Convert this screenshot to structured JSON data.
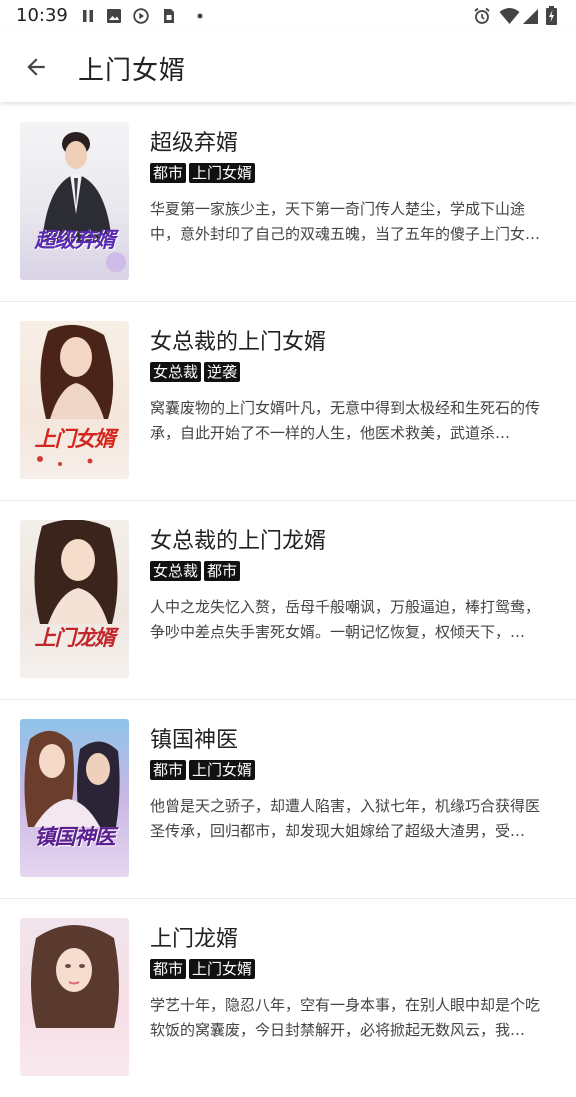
{
  "status_bar": {
    "time": "10:39",
    "icons_left": [
      "pause-icon",
      "image-icon",
      "play-circle-icon",
      "sim-card-icon",
      "dot-icon"
    ],
    "icons_right": [
      "alarm-icon",
      "wifi-icon",
      "cellular-signal-icon",
      "battery-charging-icon"
    ]
  },
  "app_bar": {
    "back_icon": "arrow-left-icon",
    "title": "上门女婿"
  },
  "colors": {
    "tag_background": "#111111",
    "tag_text": "#ffffff",
    "divider": "#ececec"
  },
  "books": [
    {
      "title": "超级弃婿",
      "tags": [
        "都市",
        "上门女婿"
      ],
      "description": "华夏第一家族少主，天下第一奇门传人楚尘，学成下山途中，意外封印了自己的双魂五魄，当了五年的傻子上门女婿……",
      "cover_text": "超级弃婿"
    },
    {
      "title": "女总裁的上门女婿",
      "tags": [
        "女总裁",
        "逆袭"
      ],
      "description": "窝囊废物的上门女婿叶凡，无意中得到太极经和生死石的传承，自此开始了不一样的人生，他医术救美，武道杀敌，……",
      "cover_text": "上门女婿"
    },
    {
      "title": "女总裁的上门龙婿",
      "tags": [
        "女总裁",
        "都市"
      ],
      "description": "人中之龙失忆入赘，岳母千般嘲讽，万般逼迫，棒打鸳鸯，争吵中差点失手害死女婿。一朝记忆恢复，权倾天下，财……",
      "cover_text": "上门龙婿"
    },
    {
      "title": "镇国神医",
      "tags": [
        "都市",
        "上门女婿"
      ],
      "description": "他曾是天之骄子，却遭人陷害，入狱七年，机缘巧合获得医圣传承，回归都市，却发现大姐嫁给了超级大渣男，受尽……",
      "cover_text": "镇国神医"
    },
    {
      "title": "上门龙婿",
      "tags": [
        "都市",
        "上门女婿"
      ],
      "description": "学艺十年，隐忍八年，空有一身本事，在别人眼中却是个吃软饭的窝囊废，今日封禁解开，必将掀起无数风云，我是……",
      "cover_text": ""
    }
  ]
}
